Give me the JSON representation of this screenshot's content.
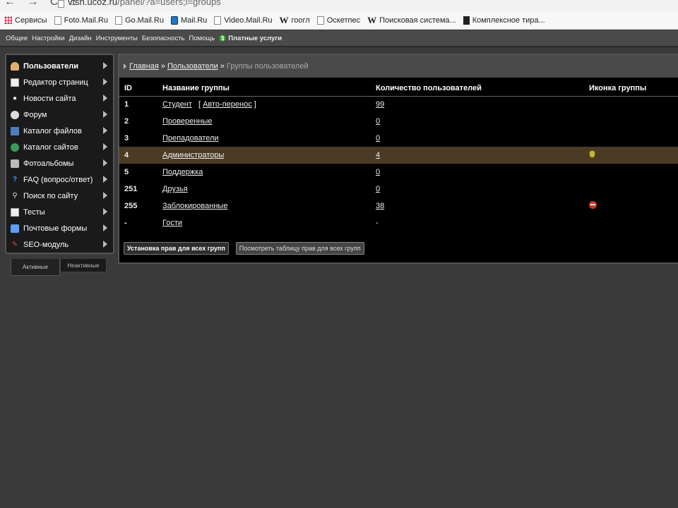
{
  "browser": {
    "url_domain": "vtsh.ucoz.ru",
    "url_path": "/panel/?a=users;l=groups"
  },
  "bookmarks": [
    {
      "label": "Сервисы",
      "icon": "apps-icon"
    },
    {
      "label": "Foto.Mail.Ru",
      "icon": "page-icon"
    },
    {
      "label": "Go.Mail.Ru",
      "icon": "page-icon"
    },
    {
      "label": "Mail.Ru",
      "icon": "mail-icon"
    },
    {
      "label": "Video.Mail.Ru",
      "icon": "page-icon"
    },
    {
      "label": "гоогл",
      "icon": "w-icon"
    },
    {
      "label": "Оскетпес",
      "icon": "page-icon"
    },
    {
      "label": "Поисковая система...",
      "icon": "w-icon"
    },
    {
      "label": "Комплексное тира...",
      "icon": "book-icon"
    }
  ],
  "topmenu": {
    "items": [
      "Общее",
      "Настройки",
      "Дизайн",
      "Инструменты",
      "Безопасность",
      "Помощь"
    ],
    "paid_label": "Платные услуги"
  },
  "sidebar": {
    "items": [
      {
        "label": "Пользователи",
        "icon": "user-icon"
      },
      {
        "label": "Редактор страниц",
        "icon": "page-icon"
      },
      {
        "label": "Новости сайта",
        "icon": "bulb-icon"
      },
      {
        "label": "Форум",
        "icon": "chat-icon"
      },
      {
        "label": "Каталог файлов",
        "icon": "file-icon"
      },
      {
        "label": "Каталог сайтов",
        "icon": "globe-icon"
      },
      {
        "label": "Фотоальбомы",
        "icon": "photo-icon"
      },
      {
        "label": "FAQ (вопрос/ответ)",
        "icon": "help-icon"
      },
      {
        "label": "Поиск по сайту",
        "icon": "search-icon"
      },
      {
        "label": "Тесты",
        "icon": "page-icon"
      },
      {
        "label": "Почтовые формы",
        "icon": "mail-icon"
      },
      {
        "label": "SEO-модуль",
        "icon": "seo-icon"
      }
    ],
    "tabs": {
      "active": "Активные",
      "inactive": "Неактивные"
    }
  },
  "breadcrumb": {
    "home": "Главная",
    "users": "Пользователи",
    "current": "Группы пользователей",
    "sep": "»"
  },
  "table": {
    "headers": {
      "id": "ID",
      "name": "Название группы",
      "count": "Количество пользователей",
      "icon": "Иконка группы"
    },
    "rows": [
      {
        "id": "1",
        "name": "Студент",
        "extra": "Авто-перенос",
        "count": "99",
        "icon": ""
      },
      {
        "id": "2",
        "name": "Проверенные",
        "count": "0",
        "icon": ""
      },
      {
        "id": "3",
        "name": "Препадователи",
        "count": "0",
        "icon": ""
      },
      {
        "id": "4",
        "name": "Администраторы",
        "count": "4",
        "icon": "gold-badge"
      },
      {
        "id": "5",
        "name": "Поддержка",
        "count": "0",
        "icon": ""
      },
      {
        "id": "251",
        "name": "Друзья",
        "count": "0",
        "icon": ""
      },
      {
        "id": "255",
        "name": "Заблокированные",
        "count": "38",
        "icon": "stop-badge"
      },
      {
        "id": "-",
        "name": "Гости",
        "count": "-",
        "icon": ""
      }
    ]
  },
  "buttons": {
    "set_rights": "Установка прав для всех групп",
    "view_rights": "Посмотреть таблицу прав для всех групп"
  },
  "colors": {
    "highlight_row": "#4b3b25",
    "panel_bg": "#3a3a3a"
  }
}
